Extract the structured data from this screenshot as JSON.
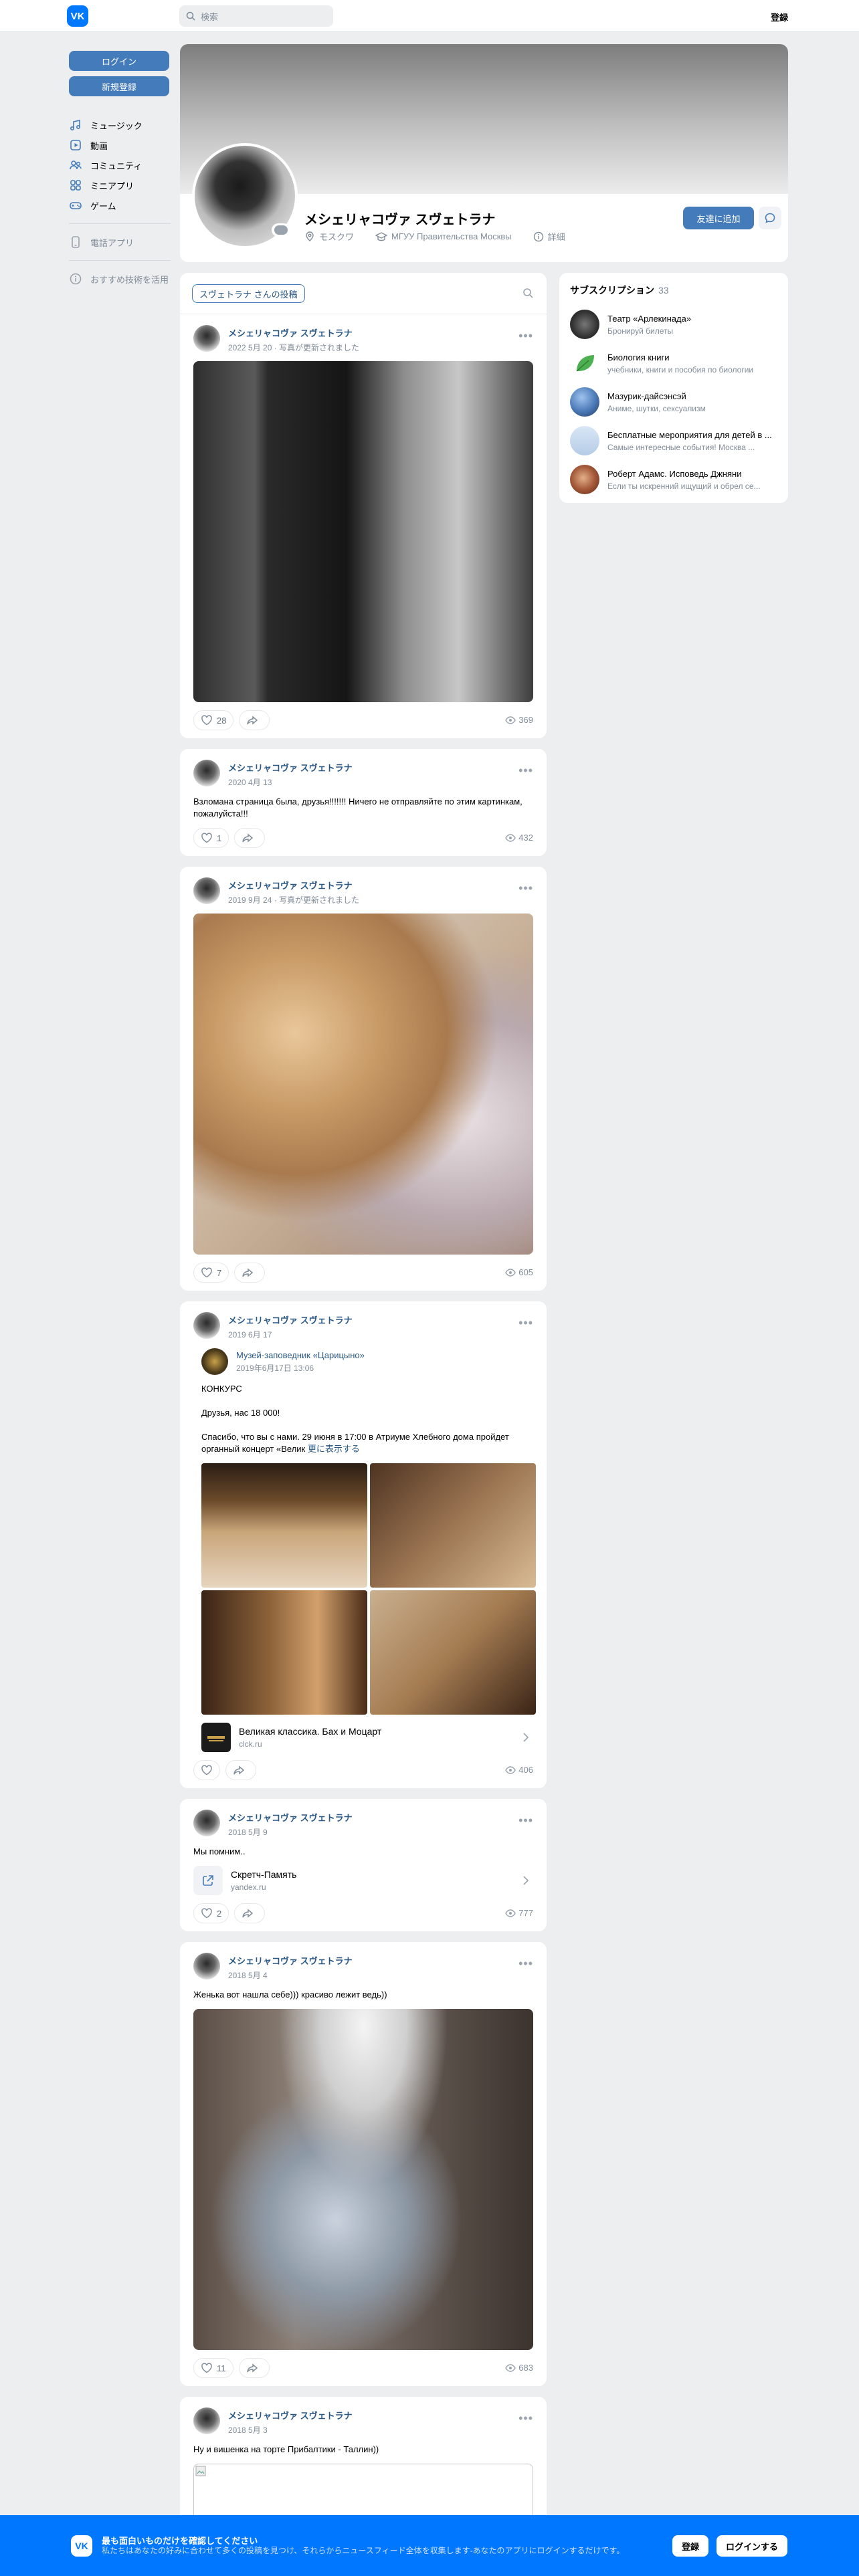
{
  "header": {
    "logo": "VK",
    "search_placeholder": "検索",
    "register": "登録"
  },
  "left": {
    "login": "ログイン",
    "signup": "新規登録",
    "nav": [
      "ミュージック",
      "動画",
      "コミュニティ",
      "ミニアプリ",
      "ゲーム"
    ],
    "phone_app": "電話アプリ",
    "advert": "おすすめ技術を活用"
  },
  "profile": {
    "name": "メシェリャコヴァ スヴェトラナ",
    "city": "モスクワ",
    "university": "МГУУ Правительства Москвы",
    "details": "詳細",
    "add_friend": "友達に追加"
  },
  "feed": {
    "tab": "スヴェトラナ さんの投稿",
    "posts": [
      {
        "author": "メシェリャコヴァ スヴェトラナ",
        "date": "2022 5月 20 · 写真が更新されました",
        "likes": "28",
        "views": "369"
      },
      {
        "author": "メシェリャコヴァ スヴェトラナ",
        "date": "2020 4月 13",
        "text": "Взломана страница была, друзья!!!!!!! Ничего не отправляйте по этим картинкам, пожалуйста!!!",
        "likes": "1",
        "views": "432"
      },
      {
        "author": "メシェリャコヴァ スヴェトラナ",
        "date": "2019 9月 24 · 写真が更新されました",
        "likes": "7",
        "views": "605"
      },
      {
        "author": "メシェリャコヴァ スヴェトラナ",
        "date": "2019 6月 17",
        "repost_name": "Музей-заповедник «Царицыно»",
        "repost_date": "2019年6月17日 13:06",
        "text1": "КОНКУРС",
        "text2": "Друзья, нас 18 000!",
        "text3": "Спасибо, что вы с нами. 29 июня в 17:00 в Атриуме Хлебного дома пройдет органный концерт «Велик",
        "more": "更に表示する",
        "link_title": "Великая классика. Бах и Моцарт",
        "link_domain": "clck.ru",
        "views": "406"
      },
      {
        "author": "メシェリャコヴァ スヴェトラナ",
        "date": "2018 5月 9",
        "text": "Мы помним..",
        "link_title": "Скретч-Память",
        "link_domain": "yandex.ru",
        "likes": "2",
        "views": "777"
      },
      {
        "author": "メシェリャコヴァ スヴェトラナ",
        "date": "2018 5月 4",
        "text": "Женька вот нашла себе))) красиво лежит ведь))",
        "likes": "11",
        "views": "683"
      },
      {
        "author": "メシェリャコヴァ スヴェトラナ",
        "date": "2018 5月 3",
        "text": "Ну и вишенка на торте Прибалтики - Таллин))"
      }
    ]
  },
  "subscriptions": {
    "title": "サブスクリプション",
    "count": "33",
    "items": [
      {
        "name": "Театр «Арлекинада»",
        "desc": "Бронируй билеты"
      },
      {
        "name": "Биология книги",
        "desc": "учебники, книги и пособия по биологии"
      },
      {
        "name": "Мазурик-дайсэнсэй",
        "desc": "Аниме, шутки, сексуализм"
      },
      {
        "name": "Бесплатные мероприятия для детей в ...",
        "desc": "Самые интересные события! Москва ..."
      },
      {
        "name": "Роберт Адамс. Исповедь Джняни",
        "desc": "Если ты искренний ищущий и обрел се..."
      }
    ]
  },
  "banner": {
    "title": "最も面白いものだけを確認してください",
    "desc": "私たちはあなたの好みに合わせて多くの投稿を見つけ、それらからニュースフィード全体を収集します-あなたのアプリにログインするだけです。",
    "register": "登録",
    "login": "ログインする"
  },
  "colors": {
    "brand": "#0077ff",
    "button": "#447bba",
    "link": "#2a5885",
    "bg": "#edeef0"
  }
}
